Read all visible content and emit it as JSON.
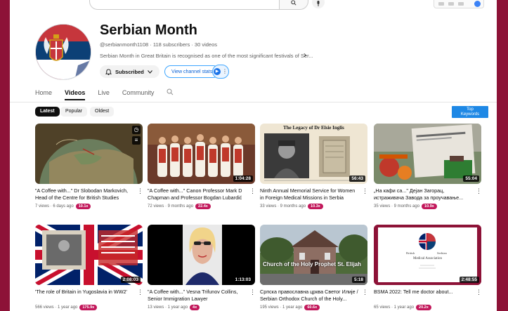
{
  "search": {
    "button_icon": "search-icon",
    "mic_icon": "mic-icon"
  },
  "channel": {
    "name": "Serbian Month",
    "meta": "@serbianmonth1108 · 118 subscribers · 30 videos",
    "description": "Serbian Month in Great Britain is recognised as one of the most significant festivals of Ser...",
    "more": "›",
    "subscribed_label": "Subscribed",
    "view_stats_label": "View channel stats"
  },
  "tabs": [
    "Home",
    "Videos",
    "Live",
    "Community"
  ],
  "active_tab": "Videos",
  "filters": {
    "latest": "Latest",
    "popular": "Popular",
    "oldest": "Oldest"
  },
  "top_keywords": {
    "line1": "Top",
    "line2": "Keywords"
  },
  "colors": {
    "accent": "#065fd4",
    "badge": "#c2185b",
    "frame": "#8d1237"
  },
  "videos": [
    {
      "title": "\"A Coffee with...\" Dr Slobodan Markovich, Head of the Centre for British Studies",
      "views": "7 views · 6 days ago",
      "badge": "10.1x",
      "duration": ""
    },
    {
      "title": "\"A Coffee with...\" Canon Professor Mark D Chapman and Professor Bogdan Lubardić ...",
      "views": "72 views · 9 months ago",
      "badge": "22.4x",
      "duration": "1:04:28"
    },
    {
      "title": "Ninth Annual Memorial Service for Women in Foreign Medical Missions in Serbia",
      "views": "33 views · 9 months ago",
      "badge": "10.3x",
      "duration": "56:43"
    },
    {
      "title": "„На кафи са...\" Дејан Загорац, истраживача Завода за проучавање...",
      "views": "35 views · 9 months ago",
      "badge": "10.9x",
      "duration": "55:04"
    },
    {
      "title": "'The role of Britain in Yugoslavia in WW2'",
      "views": "566 views · 1 year ago",
      "badge": "175.9x",
      "duration": "2:08:03"
    },
    {
      "title": "\"A Coffee with...\" Vesna Trifunov Collins, Senior Immigration Lawyer",
      "views": "13 views · 1 year ago",
      "badge": "4x",
      "duration": "1:13:03"
    },
    {
      "title": "Српска православна црква Светог Илије / Serbian Orthodox Church of the Holy...",
      "views": "195 views · 1 year ago",
      "badge": "60.6x",
      "duration": "5:18"
    },
    {
      "title": "BSMA 2022: Tell me doctor about...",
      "views": "65 views · 1 year ago",
      "badge": "20.2x",
      "duration": "2:48:55"
    }
  ],
  "thumb_text": {
    "elsie_title": "The Legacy of Dr Elsie Inglis",
    "church_caption": "Church of the Holy Prophet St. Elijah",
    "bsma_left": "British",
    "bsma_right": "Serbian",
    "bsma_line": "Medical Association"
  }
}
